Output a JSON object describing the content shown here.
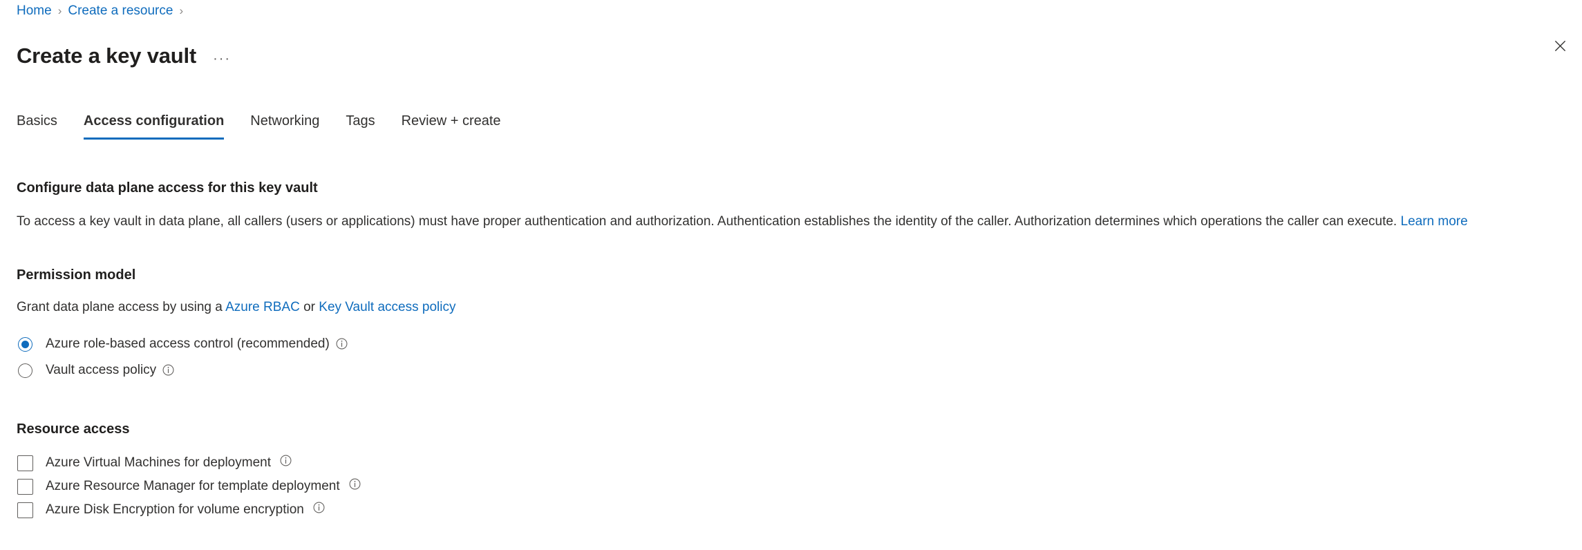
{
  "breadcrumb": {
    "items": [
      {
        "label": "Home"
      },
      {
        "label": "Create a resource"
      }
    ],
    "separator": "›"
  },
  "header": {
    "title": "Create a key vault",
    "more_label": "···",
    "close_label": "Close",
    "more_icon": "ellipsis-icon",
    "close_icon": "close-icon"
  },
  "tabs": [
    {
      "label": "Basics",
      "active": false
    },
    {
      "label": "Access configuration",
      "active": true
    },
    {
      "label": "Networking",
      "active": false
    },
    {
      "label": "Tags",
      "active": false
    },
    {
      "label": "Review + create",
      "active": false
    }
  ],
  "access_section": {
    "heading": "Configure data plane access for this key vault",
    "description_before": "To access a key vault in data plane, all callers (users or applications) must have proper authentication and authorization. Authentication establishes the identity of the caller. Authorization determines which operations the caller can execute.",
    "learn_more": "Learn more"
  },
  "permission_model": {
    "heading": "Permission model",
    "sub_prefix": "Grant data plane access by using a",
    "link_rbac": "Azure RBAC",
    "sub_mid": "or",
    "link_policy": "Key Vault access policy",
    "options": [
      {
        "label": "Azure role-based access control (recommended)",
        "selected": true,
        "info_icon": "info-icon"
      },
      {
        "label": "Vault access policy",
        "selected": false,
        "info_icon": "info-icon"
      }
    ]
  },
  "resource_access": {
    "heading": "Resource access",
    "options": [
      {
        "label": "Azure Virtual Machines for deployment",
        "checked": false,
        "info_icon": "info-icon"
      },
      {
        "label": "Azure Resource Manager for template deployment",
        "checked": false,
        "info_icon": "info-icon"
      },
      {
        "label": "Azure Disk Encryption for volume encryption",
        "checked": false,
        "info_icon": "info-icon"
      }
    ]
  },
  "colors": {
    "accent": "#0f6cbd",
    "text": "#323130",
    "heading": "#201f1e",
    "border": "#605e5c",
    "background": "#ffffff"
  }
}
